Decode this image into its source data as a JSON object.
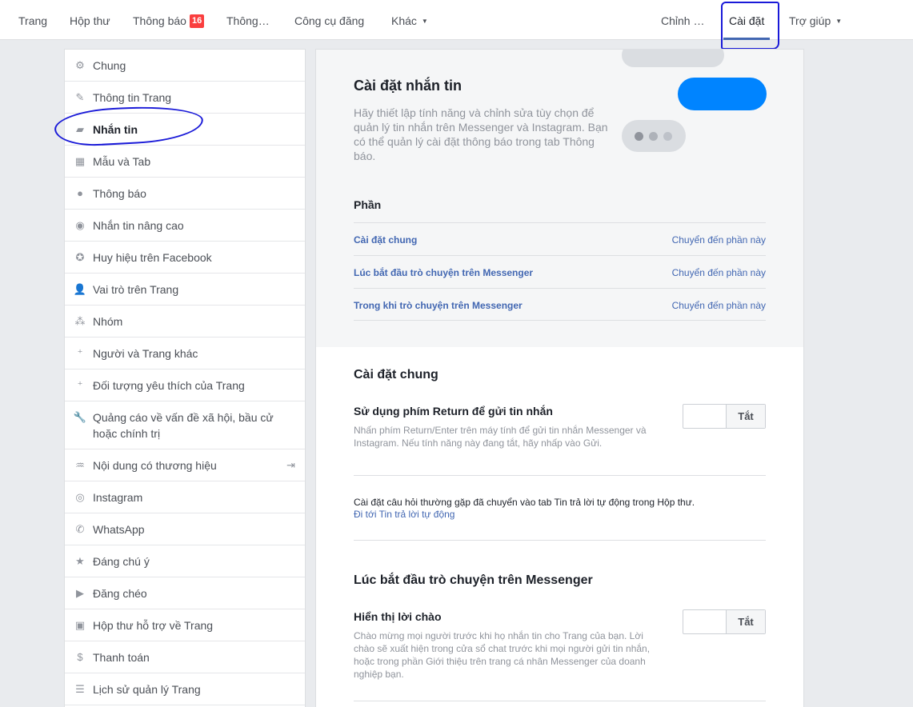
{
  "topnav": {
    "left": [
      {
        "label": "Trang"
      },
      {
        "label": "Hộp thư"
      },
      {
        "label": "Thông báo",
        "badge": "16"
      },
      {
        "label": "Thông…"
      },
      {
        "label": "Công cụ đăng"
      },
      {
        "label": "Khác"
      }
    ],
    "right": [
      {
        "label": "Chỉnh …"
      },
      {
        "label": "Cài đặt"
      },
      {
        "label": "Trợ giúp"
      }
    ],
    "active_color": "#4267b2"
  },
  "sidebar": {
    "items": [
      {
        "label": "Chung",
        "icon": "gear-icon"
      },
      {
        "label": "Thông tin Trang",
        "icon": "pencil-icon"
      },
      {
        "label": "Nhắn tin",
        "icon": "chat-icon"
      },
      {
        "label": "Mẫu và Tab",
        "icon": "grid-icon"
      },
      {
        "label": "Thông báo",
        "icon": "globe-icon"
      },
      {
        "label": "Nhắn tin nâng cao",
        "icon": "messenger-icon"
      },
      {
        "label": "Huy hiệu trên Facebook",
        "icon": "star-badge-icon"
      },
      {
        "label": "Vai trò trên Trang",
        "icon": "person-icon"
      },
      {
        "label": "Nhóm",
        "icon": "group-icon"
      },
      {
        "label": "Người và Trang khác",
        "icon": "person-plus-icon"
      },
      {
        "label": "Đối tượng yêu thích của Trang",
        "icon": "person-star-icon"
      },
      {
        "label": "Quảng cáo về vấn đề xã hội, bầu cử hoặc chính trị",
        "icon": "wrench-icon"
      },
      {
        "label": "Nội dung có thương hiệu",
        "icon": "handshake-icon"
      },
      {
        "label": "Instagram",
        "icon": "instagram-icon"
      },
      {
        "label": "WhatsApp",
        "icon": "whatsapp-icon"
      },
      {
        "label": "Đáng chú ý",
        "icon": "star-icon"
      },
      {
        "label": "Đăng chéo",
        "icon": "video-icon"
      },
      {
        "label": "Hộp thư hỗ trợ về Trang",
        "icon": "facebook-icon"
      },
      {
        "label": "Thanh toán",
        "icon": "dollar-icon"
      },
      {
        "label": "Lịch sử quản lý Trang",
        "icon": "list-icon"
      }
    ]
  },
  "hero": {
    "title": "Cài đặt nhắn tin",
    "description": "Hãy thiết lập tính năng và chỉnh sửa tùy chọn để quản lý tin nhắn trên Messenger và Instagram. Bạn có thể quản lý cài đặt thông báo trong tab Thông báo.",
    "accent": "#0084ff"
  },
  "sections": {
    "label": "Phần",
    "jump_label": "Chuyển đến phần này",
    "rows": [
      {
        "label": "Cài đặt chung"
      },
      {
        "label": "Lúc bắt đầu trò chuyện trên Messenger"
      },
      {
        "label": "Trong khi trò chuyện trên Messenger"
      }
    ]
  },
  "general": {
    "title": "Cài đặt chung",
    "option_title": "Sử dụng phím Return để gửi tin nhắn",
    "option_desc": "Nhấn phím Return/Enter trên máy tính để gửi tin nhắn Messenger và Instagram. Nếu tính năng này đang tắt, hãy nhấp vào Gửi.",
    "toggle_label": "Tắt",
    "note": "Cài đặt câu hỏi thường gặp đã chuyển vào tab Tin trả lời tự động trong Hộp thư.",
    "note_link": "Đi tới Tin trả lời tự động"
  },
  "start": {
    "title": "Lúc bắt đầu trò chuyện trên Messenger",
    "option_title": "Hiển thị lời chào",
    "option_desc": "Chào mừng mọi người trước khi họ nhắn tin cho Trang của bạn. Lời chào sẽ xuất hiện trong cửa sổ chat trước khi mọi người gửi tin nhắn, hoặc trong phần Giới thiệu trên trang cá nhân Messenger của doanh nghiệp bạn.",
    "toggle_label": "Tắt"
  }
}
